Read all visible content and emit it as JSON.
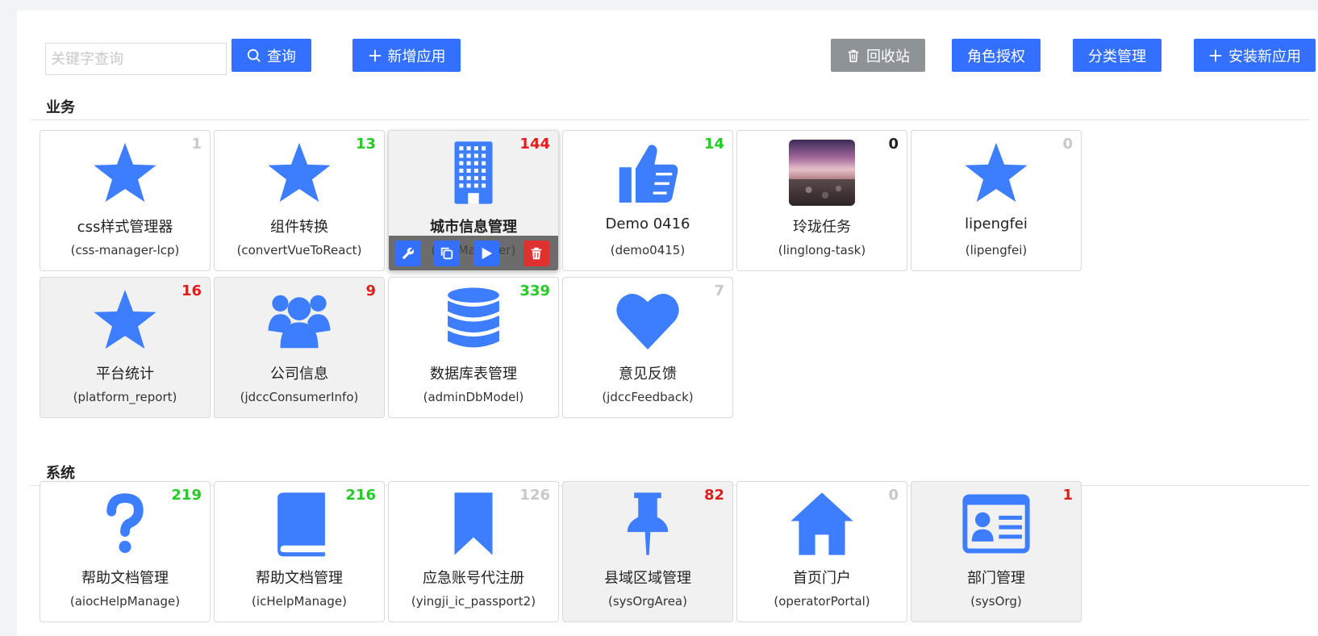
{
  "toolbar": {
    "search_placeholder": "关键字查询",
    "query_label": "查询",
    "add_app_label": "新增应用",
    "recycle_label": "回收站",
    "role_auth_label": "角色授权",
    "category_label": "分类管理",
    "install_label": "安装新应用"
  },
  "colors": {
    "primary": "#3370ff",
    "gray_button": "#8e9398",
    "count_green": "#22cc22",
    "count_red": "#e01e1e",
    "count_gray": "#c8c8c8",
    "count_black": "#222222",
    "delete_red": "#e03030"
  },
  "sections": [
    {
      "title": "业务",
      "apps": [
        {
          "name": "css样式管理器",
          "code": "(css-manager-lcp)",
          "count": "1",
          "count_color": "gray",
          "icon": "star-icon",
          "shaded": false
        },
        {
          "name": "组件转换",
          "code": "(convertVueToReact)",
          "count": "13",
          "count_color": "green",
          "icon": "star-icon",
          "shaded": false
        },
        {
          "name": "城市信息管理",
          "code": "(cityManager)",
          "count": "144",
          "count_color": "red",
          "icon": "building-icon",
          "shaded": true,
          "hovered": true
        },
        {
          "name": "Demo 0416",
          "code": "(demo0415)",
          "count": "14",
          "count_color": "green",
          "icon": "thumbs-up-icon",
          "shaded": false
        },
        {
          "name": "玲珑任务",
          "code": "(linglong-task)",
          "count": "0",
          "count_color": "black",
          "icon": "landscape-thumbnail",
          "shaded": false
        },
        {
          "name": "lipengfei",
          "code": "(lipengfei)",
          "count": "0",
          "count_color": "gray",
          "icon": "star-icon",
          "shaded": false
        },
        {
          "name": "平台统计",
          "code": "(platform_report)",
          "count": "16",
          "count_color": "red",
          "icon": "star-icon",
          "shaded": true
        },
        {
          "name": "公司信息",
          "code": "(jdccConsumerInfo)",
          "count": "9",
          "count_color": "red",
          "icon": "users-icon",
          "shaded": true
        },
        {
          "name": "数据库表管理",
          "code": "(adminDbModel)",
          "count": "339",
          "count_color": "green",
          "icon": "database-icon",
          "shaded": false
        },
        {
          "name": "意见反馈",
          "code": "(jdccFeedback)",
          "count": "7",
          "count_color": "gray",
          "icon": "heart-icon",
          "shaded": false
        }
      ]
    },
    {
      "title": "系统",
      "apps": [
        {
          "name": "帮助文档管理",
          "code": "(aiocHelpManage)",
          "count": "219",
          "count_color": "green",
          "icon": "question-icon",
          "shaded": false
        },
        {
          "name": "帮助文档管理",
          "code": "(icHelpManage)",
          "count": "216",
          "count_color": "green",
          "icon": "book-icon",
          "shaded": false
        },
        {
          "name": "应急账号代注册",
          "code": "(yingji_ic_passport2)",
          "count": "126",
          "count_color": "gray",
          "icon": "bookmark-icon",
          "shaded": false
        },
        {
          "name": "县域区域管理",
          "code": "(sysOrgArea)",
          "count": "82",
          "count_color": "red",
          "icon": "pin-icon",
          "shaded": true
        },
        {
          "name": "首页门户",
          "code": "(operatorPortal)",
          "count": "0",
          "count_color": "gray",
          "icon": "home-icon",
          "shaded": false
        },
        {
          "name": "部门管理",
          "code": "(sysOrg)",
          "count": "1",
          "count_color": "red",
          "icon": "id-card-icon",
          "shaded": true
        }
      ]
    }
  ],
  "hover_actions": [
    {
      "icon": "wrench-icon",
      "color": "blue"
    },
    {
      "icon": "copy-icon",
      "color": "blue"
    },
    {
      "icon": "play-icon",
      "color": "blue"
    },
    {
      "icon": "trash-icon",
      "color": "red"
    }
  ]
}
